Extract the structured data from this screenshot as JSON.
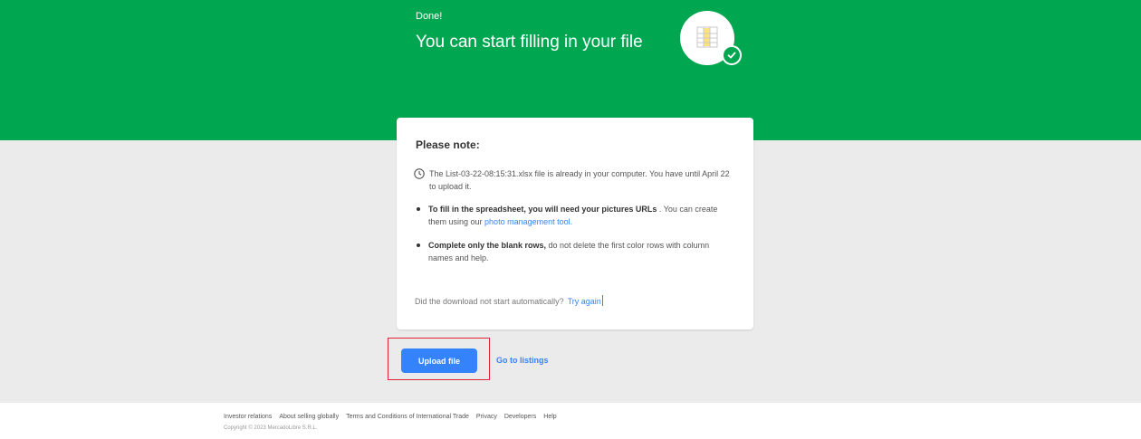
{
  "hero": {
    "status": "Done!",
    "title": "You can start filling in your file",
    "badge_icon": "spreadsheet-icon",
    "check_icon": "check-icon"
  },
  "card": {
    "title": "Please note:",
    "file_note": {
      "icon": "clock-icon",
      "text": "The List-03-22-08:15:31.xlsx file is already in your computer. You have until April 22 to upload it."
    },
    "bullet1": {
      "bold": "To fill in the spreadsheet, you will need your pictures URLs",
      "text": " . You can create them using our ",
      "link": "photo management tool."
    },
    "bullet2": {
      "bold": "Complete only the blank rows,",
      "text": " do not delete the first color rows with column names and help."
    },
    "retry": {
      "question": "Did the download not start automatically?",
      "link": "Try again"
    }
  },
  "actions": {
    "upload_label": "Upload file",
    "listings_label": "Go to listings"
  },
  "footer": {
    "links": [
      "Investor relations",
      "About selling globally",
      "Terms and Conditions of International Trade",
      "Privacy",
      "Developers",
      "Help"
    ],
    "copyright": "Copyright © 2023 MercadoLibre S.R.L."
  },
  "colors": {
    "brand_green": "#00a650",
    "accent_blue": "#3483fa",
    "highlight_red": "#e0243a",
    "background_grey": "#ebebeb"
  }
}
